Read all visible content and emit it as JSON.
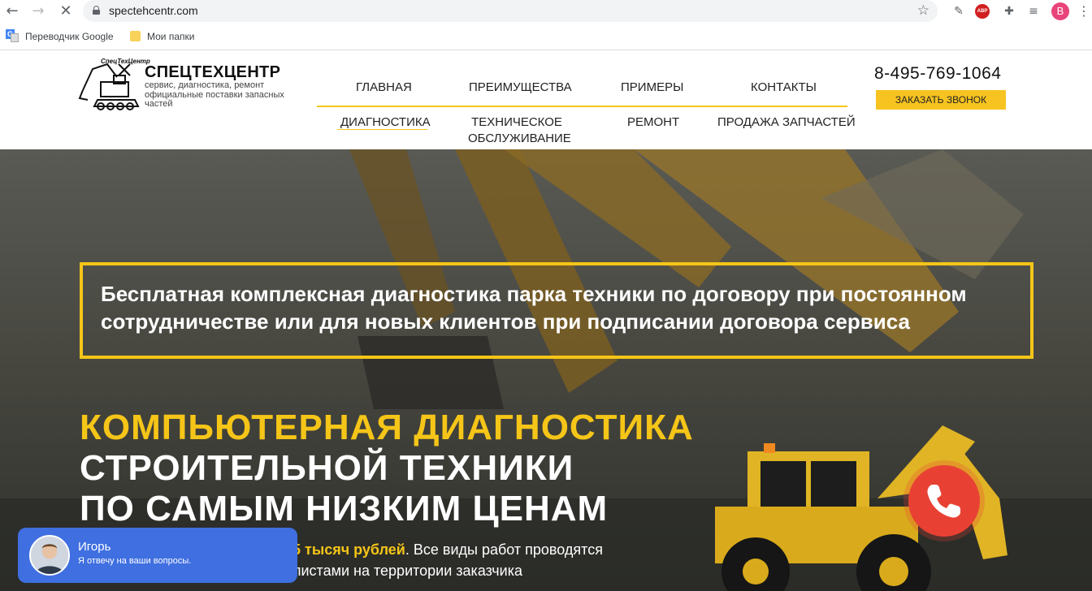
{
  "browser": {
    "url": "spectehcentr.com",
    "profile_initial": "B",
    "abp_label": "ABP",
    "bookmarks": [
      {
        "label": "Переводчик Google",
        "icon": "google-translate-icon"
      },
      {
        "label": "Мои папки",
        "icon": "folder-icon"
      }
    ]
  },
  "header": {
    "logo_small": "СпецТехЦентр",
    "logo_title": "СПЕЦТЕХЦЕНТР",
    "logo_sub": "сервис, диагностика, ремонт официальные поставки запасных частей",
    "menu_top": [
      "ГЛАВНАЯ",
      "ПРЕИМУЩЕСТВА",
      "ПРИМЕРЫ",
      "КОНТАКТЫ"
    ],
    "menu_bottom": [
      "ДИАГНОСТИКА",
      "ТЕХНИЧЕСКОЕ ОБСЛУЖИВАНИЕ",
      "РЕМОНТ",
      "ПРОДАЖА ЗАПЧАСТЕЙ"
    ],
    "active_item": "ДИАГНОСТИКА",
    "phone": "8-495-769-1064",
    "callback_button": "ЗАКАЗАТЬ ЗВОНОК"
  },
  "hero": {
    "promo": "Бесплатная комплексная диагностика парка техники по договору при постоянном сотрудничестве или для новых клиентов при подписании договора сервиса",
    "headline_yellow": "КОМПЬЮТЕРНАЯ ДИАГНОСТИКА",
    "headline_white_1": "СТРОИТЕЛЬНОЙ ТЕХНИКИ",
    "headline_white_2": "ПО САМЫМ НИЗКИМ ЦЕНАМ",
    "desc_highlight": "5 тысяч рублей",
    "desc_rest": ". Все виды работ проводятся",
    "desc_line2": "листами на территории заказчика"
  },
  "chat": {
    "name": "Игорь",
    "message": "Я отвечу на ваши вопросы."
  },
  "colors": {
    "accent": "#f5c518",
    "call_red": "#e84134",
    "chat_blue": "#3f6fe0"
  }
}
